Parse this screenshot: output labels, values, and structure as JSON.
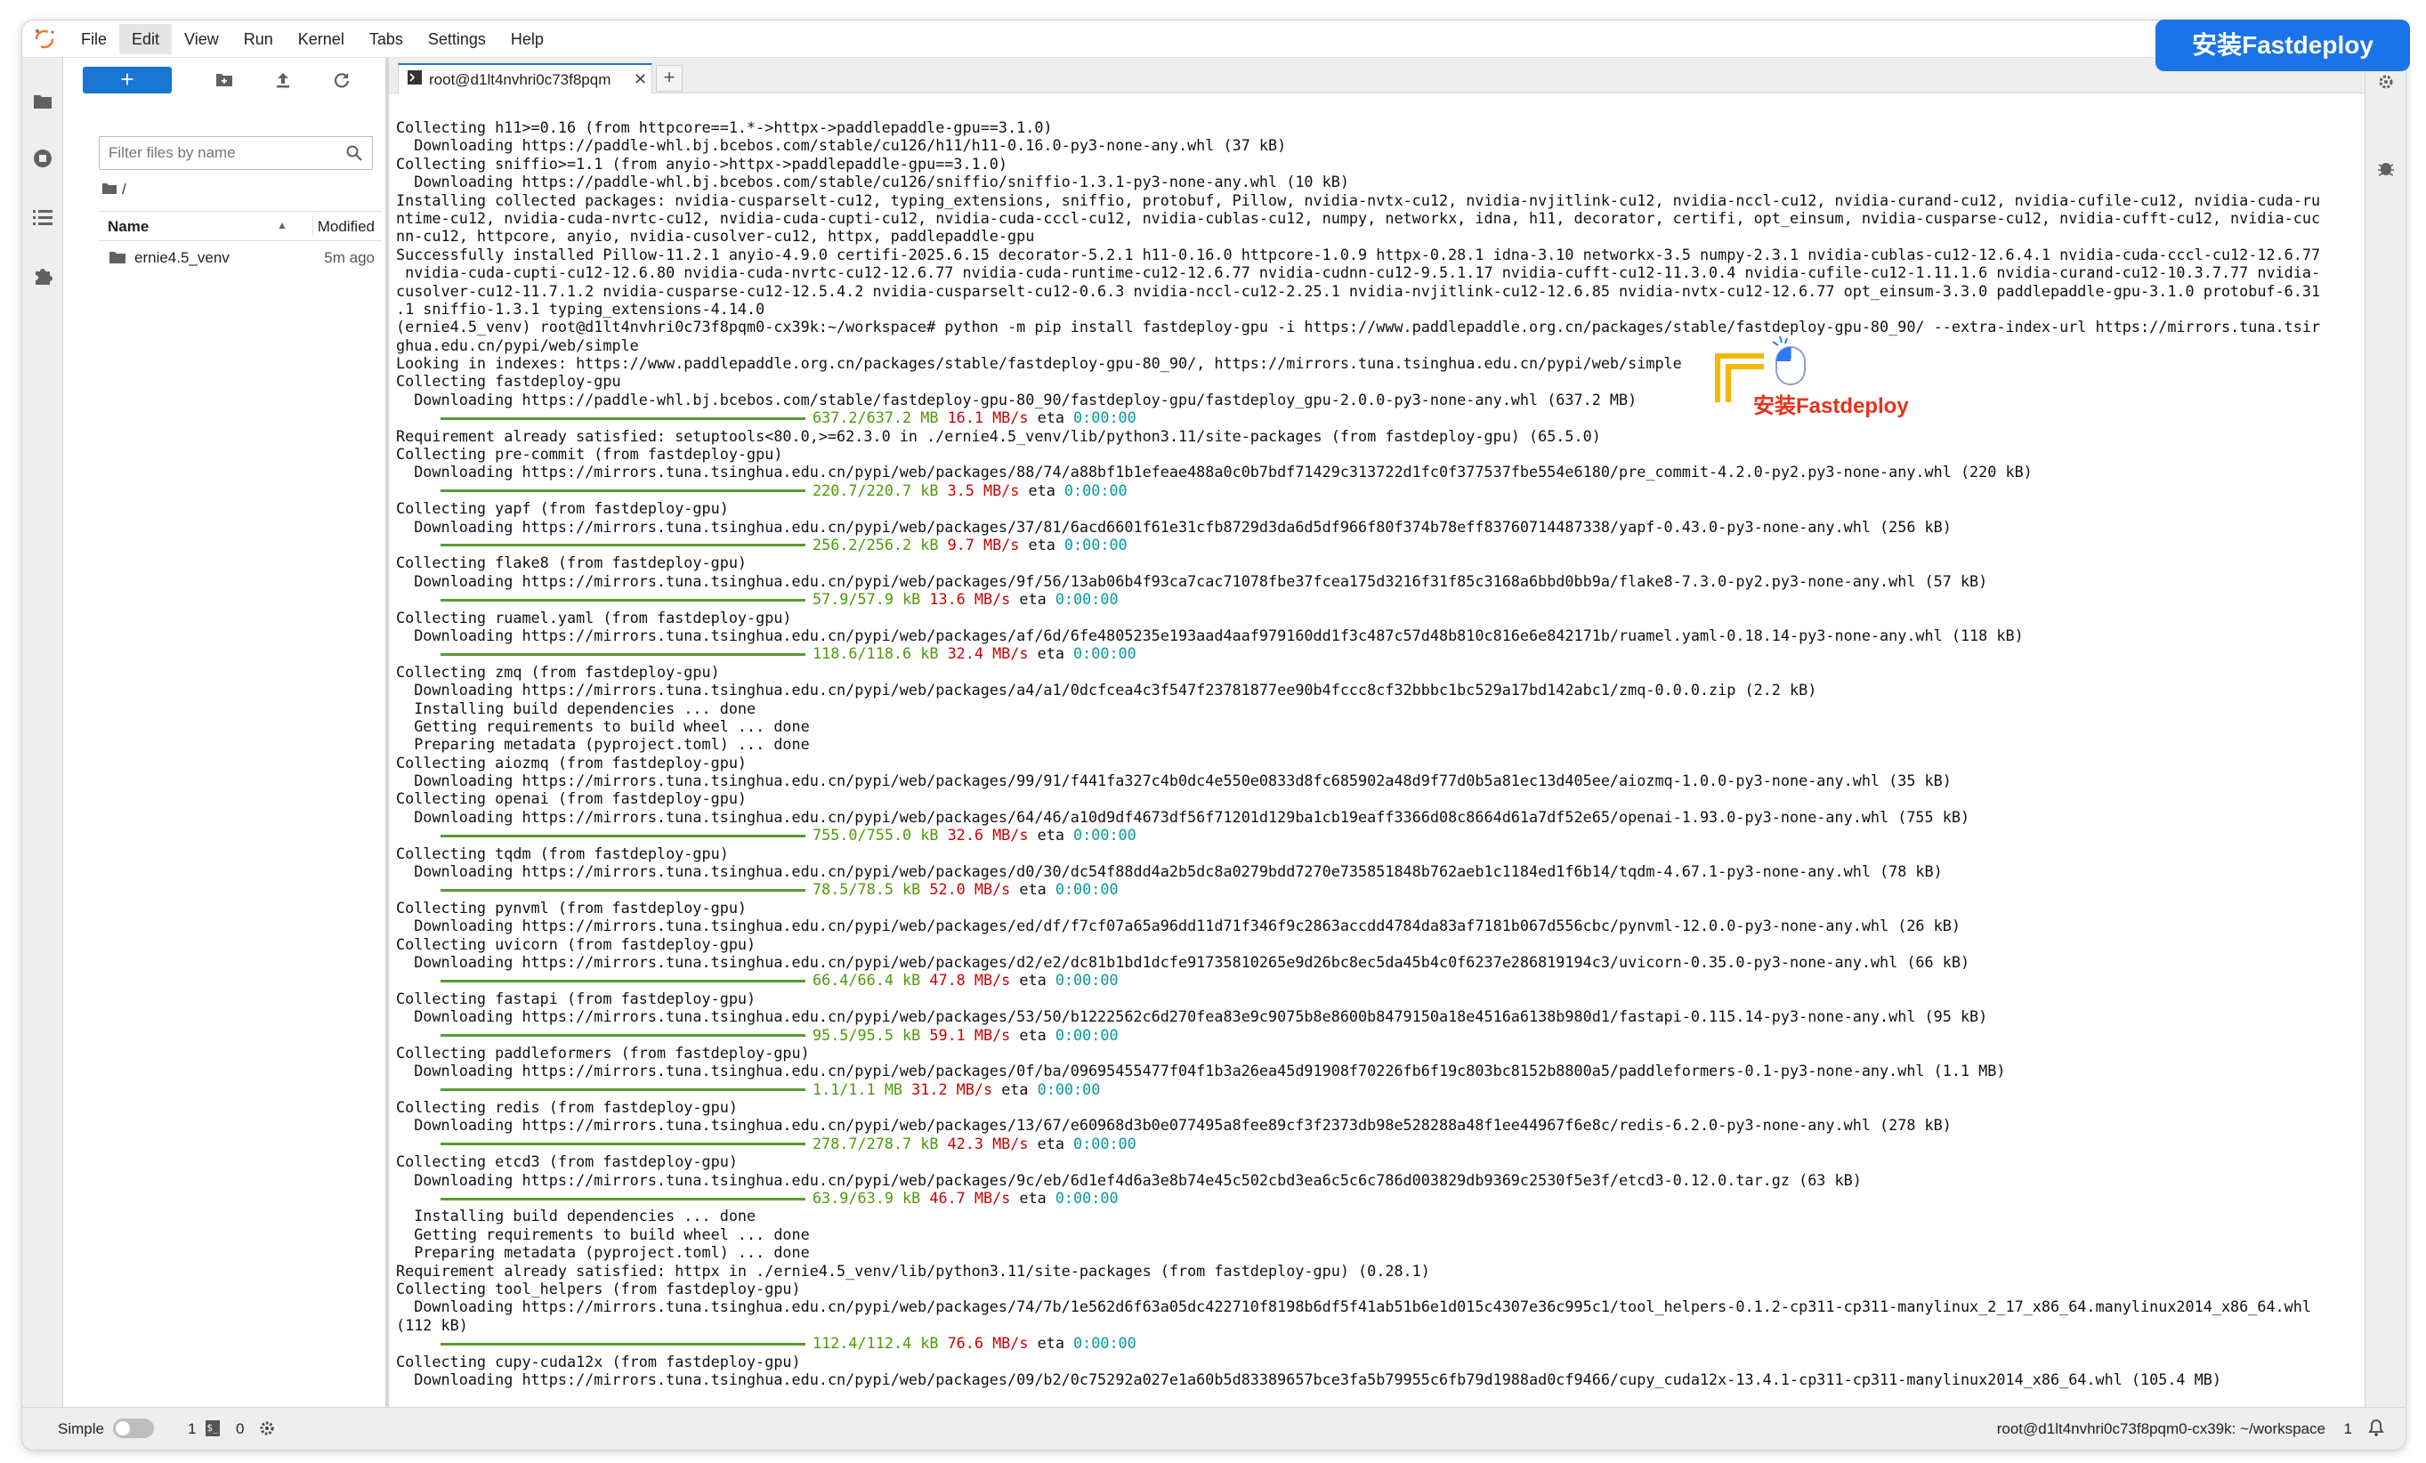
{
  "menubar": {
    "items": [
      "File",
      "Edit",
      "View",
      "Run",
      "Kernel",
      "Tabs",
      "Settings",
      "Help"
    ],
    "active": "Edit"
  },
  "banner": {
    "text": "安装Fastdeploy"
  },
  "filebrowser": {
    "new_label": "+",
    "search_placeholder": "Filter files by name",
    "breadcrumb": "/",
    "columns": {
      "name": "Name",
      "modified": "Modified"
    },
    "rows": [
      {
        "name": "ernie4.5_venv",
        "modified": "5m ago"
      }
    ]
  },
  "tab": {
    "label": "root@d1lt4nvhri0c73f8pqm",
    "new_tab": "+"
  },
  "overlay": {
    "label": "安装Fastdeploy"
  },
  "status": {
    "mode_label": "Simple",
    "terminals": "1",
    "kernels": "0",
    "host": "root@d1lt4nvhri0c73f8pqm0-cx39k: ~/workspace",
    "count": "1"
  },
  "terminal": {
    "lines": [
      {
        "t": "Collecting h11>=0.16 (from httpcore==1.*->httpx->paddlepaddle-gpu==3.1.0)"
      },
      {
        "t": "  Downloading https://paddle-whl.bj.bcebos.com/stable/cu126/h11/h11-0.16.0-py3-none-any.whl (37 kB)"
      },
      {
        "t": "Collecting sniffio>=1.1 (from anyio->httpx->paddlepaddle-gpu==3.1.0)"
      },
      {
        "t": "  Downloading https://paddle-whl.bj.bcebos.com/stable/cu126/sniffio/sniffio-1.3.1-py3-none-any.whl (10 kB)"
      },
      {
        "t": "Installing collected packages: nvidia-cusparselt-cu12, typing_extensions, sniffio, protobuf, Pillow, nvidia-nvtx-cu12, nvidia-nvjitlink-cu12, nvidia-nccl-cu12, nvidia-curand-cu12, nvidia-cufile-cu12, nvidia-cuda-ru"
      },
      {
        "t": "ntime-cu12, nvidia-cuda-nvrtc-cu12, nvidia-cuda-cupti-cu12, nvidia-cuda-cccl-cu12, nvidia-cublas-cu12, numpy, networkx, idna, h11, decorator, certifi, opt_einsum, nvidia-cusparse-cu12, nvidia-cufft-cu12, nvidia-cuc"
      },
      {
        "t": "nn-cu12, httpcore, anyio, nvidia-cusolver-cu12, httpx, paddlepaddle-gpu"
      },
      {
        "t": "Successfully installed Pillow-11.2.1 anyio-4.9.0 certifi-2025.6.15 decorator-5.2.1 h11-0.16.0 httpcore-1.0.9 httpx-0.28.1 idna-3.10 networkx-3.5 numpy-2.3.1 nvidia-cublas-cu12-12.6.4.1 nvidia-cuda-cccl-cu12-12.6.77"
      },
      {
        "t": " nvidia-cuda-cupti-cu12-12.6.80 nvidia-cuda-nvrtc-cu12-12.6.77 nvidia-cuda-runtime-cu12-12.6.77 nvidia-cudnn-cu12-9.5.1.17 nvidia-cufft-cu12-11.3.0.4 nvidia-cufile-cu12-1.11.1.6 nvidia-curand-cu12-10.3.7.77 nvidia-"
      },
      {
        "t": "cusolver-cu12-11.7.1.2 nvidia-cusparse-cu12-12.5.4.2 nvidia-cusparselt-cu12-0.6.3 nvidia-nccl-cu12-2.25.1 nvidia-nvjitlink-cu12-12.6.85 nvidia-nvtx-cu12-12.6.77 opt_einsum-3.3.0 paddlepaddle-gpu-3.1.0 protobuf-6.31"
      },
      {
        "t": ".1 sniffio-1.3.1 typing_extensions-4.14.0"
      },
      {
        "t": "(ernie4.5_venv) root@d1lt4nvhri0c73f8pqm0-cx39k:~/workspace# python -m pip install fastdeploy-gpu -i https://www.paddlepaddle.org.cn/packages/stable/fastdeploy-gpu-80_90/ --extra-index-url https://mirrors.tuna.tsir"
      },
      {
        "t": "ghua.edu.cn/pypi/web/simple"
      },
      {
        "t": "Looking in indexes: https://www.paddlepaddle.org.cn/packages/stable/fastdeploy-gpu-80_90/, https://mirrors.tuna.tsinghua.edu.cn/pypi/web/simple"
      },
      {
        "t": "Collecting fastdeploy-gpu"
      },
      {
        "t": "  Downloading https://paddle-whl.bj.bcebos.com/stable/fastdeploy-gpu-80_90/fastdeploy-gpu/fastdeploy_gpu-2.0.0-py3-none-any.whl (637.2 MB)"
      },
      {
        "p": [
          "637.2/637.2 MB",
          "16.1 MB/s",
          "0:00:00"
        ]
      },
      {
        "t": "Requirement already satisfied: setuptools<80.0,>=62.3.0 in ./ernie4.5_venv/lib/python3.11/site-packages (from fastdeploy-gpu) (65.5.0)"
      },
      {
        "t": "Collecting pre-commit (from fastdeploy-gpu)"
      },
      {
        "t": "  Downloading https://mirrors.tuna.tsinghua.edu.cn/pypi/web/packages/88/74/a88bf1b1efeae488a0c0b7bdf71429c313722d1fc0f377537fbe554e6180/pre_commit-4.2.0-py2.py3-none-any.whl (220 kB)"
      },
      {
        "p": [
          "220.7/220.7 kB",
          "3.5 MB/s",
          "0:00:00"
        ]
      },
      {
        "t": "Collecting yapf (from fastdeploy-gpu)"
      },
      {
        "t": "  Downloading https://mirrors.tuna.tsinghua.edu.cn/pypi/web/packages/37/81/6acd6601f61e31cfb8729d3da6d5df966f80f374b78eff83760714487338/yapf-0.43.0-py3-none-any.whl (256 kB)"
      },
      {
        "p": [
          "256.2/256.2 kB",
          "9.7 MB/s",
          "0:00:00"
        ]
      },
      {
        "t": "Collecting flake8 (from fastdeploy-gpu)"
      },
      {
        "t": "  Downloading https://mirrors.tuna.tsinghua.edu.cn/pypi/web/packages/9f/56/13ab06b4f93ca7cac71078fbe37fcea175d3216f31f85c3168a6bbd0bb9a/flake8-7.3.0-py2.py3-none-any.whl (57 kB)"
      },
      {
        "p": [
          "57.9/57.9 kB",
          "13.6 MB/s",
          "0:00:00"
        ]
      },
      {
        "t": "Collecting ruamel.yaml (from fastdeploy-gpu)"
      },
      {
        "t": "  Downloading https://mirrors.tuna.tsinghua.edu.cn/pypi/web/packages/af/6d/6fe4805235e193aad4aaf979160dd1f3c487c57d48b810c816e6e842171b/ruamel.yaml-0.18.14-py3-none-any.whl (118 kB)"
      },
      {
        "p": [
          "118.6/118.6 kB",
          "32.4 MB/s",
          "0:00:00"
        ]
      },
      {
        "t": "Collecting zmq (from fastdeploy-gpu)"
      },
      {
        "t": "  Downloading https://mirrors.tuna.tsinghua.edu.cn/pypi/web/packages/a4/a1/0dcfcea4c3f547f23781877ee90b4fccc8cf32bbbc1bc529a17bd142abc1/zmq-0.0.0.zip (2.2 kB)"
      },
      {
        "t": "  Installing build dependencies ... done"
      },
      {
        "t": "  Getting requirements to build wheel ... done"
      },
      {
        "t": "  Preparing metadata (pyproject.toml) ... done"
      },
      {
        "t": "Collecting aiozmq (from fastdeploy-gpu)"
      },
      {
        "t": "  Downloading https://mirrors.tuna.tsinghua.edu.cn/pypi/web/packages/99/91/f441fa327c4b0dc4e550e0833d8fc685902a48d9f77d0b5a81ec13d405ee/aiozmq-1.0.0-py3-none-any.whl (35 kB)"
      },
      {
        "t": "Collecting openai (from fastdeploy-gpu)"
      },
      {
        "t": "  Downloading https://mirrors.tuna.tsinghua.edu.cn/pypi/web/packages/64/46/a10d9df4673df56f71201d129ba1cb19eaff3366d08c8664d61a7df52e65/openai-1.93.0-py3-none-any.whl (755 kB)"
      },
      {
        "p": [
          "755.0/755.0 kB",
          "32.6 MB/s",
          "0:00:00"
        ]
      },
      {
        "t": "Collecting tqdm (from fastdeploy-gpu)"
      },
      {
        "t": "  Downloading https://mirrors.tuna.tsinghua.edu.cn/pypi/web/packages/d0/30/dc54f88dd4a2b5dc8a0279bdd7270e735851848b762aeb1c1184ed1f6b14/tqdm-4.67.1-py3-none-any.whl (78 kB)"
      },
      {
        "p": [
          "78.5/78.5 kB",
          "52.0 MB/s",
          "0:00:00"
        ]
      },
      {
        "t": "Collecting pynvml (from fastdeploy-gpu)"
      },
      {
        "t": "  Downloading https://mirrors.tuna.tsinghua.edu.cn/pypi/web/packages/ed/df/f7cf07a65a96dd11d71f346f9c2863accdd4784da83af7181b067d556cbc/pynvml-12.0.0-py3-none-any.whl (26 kB)"
      },
      {
        "t": "Collecting uvicorn (from fastdeploy-gpu)"
      },
      {
        "t": "  Downloading https://mirrors.tuna.tsinghua.edu.cn/pypi/web/packages/d2/e2/dc81b1bd1dcfe91735810265e9d26bc8ec5da45b4c0f6237e286819194c3/uvicorn-0.35.0-py3-none-any.whl (66 kB)"
      },
      {
        "p": [
          "66.4/66.4 kB",
          "47.8 MB/s",
          "0:00:00"
        ]
      },
      {
        "t": "Collecting fastapi (from fastdeploy-gpu)"
      },
      {
        "t": "  Downloading https://mirrors.tuna.tsinghua.edu.cn/pypi/web/packages/53/50/b1222562c6d270fea83e9c9075b8e8600b8479150a18e4516a6138b980d1/fastapi-0.115.14-py3-none-any.whl (95 kB)"
      },
      {
        "p": [
          "95.5/95.5 kB",
          "59.1 MB/s",
          "0:00:00"
        ]
      },
      {
        "t": "Collecting paddleformers (from fastdeploy-gpu)"
      },
      {
        "t": "  Downloading https://mirrors.tuna.tsinghua.edu.cn/pypi/web/packages/0f/ba/09695455477f04f1b3a26ea45d91908f70226fb6f19c803bc8152b8800a5/paddleformers-0.1-py3-none-any.whl (1.1 MB)"
      },
      {
        "p": [
          "1.1/1.1 MB",
          "31.2 MB/s",
          "0:00:00"
        ]
      },
      {
        "t": "Collecting redis (from fastdeploy-gpu)"
      },
      {
        "t": "  Downloading https://mirrors.tuna.tsinghua.edu.cn/pypi/web/packages/13/67/e60968d3b0e077495a8fee89cf3f2373db98e528288a48f1ee44967f6e8c/redis-6.2.0-py3-none-any.whl (278 kB)"
      },
      {
        "p": [
          "278.7/278.7 kB",
          "42.3 MB/s",
          "0:00:00"
        ]
      },
      {
        "t": "Collecting etcd3 (from fastdeploy-gpu)"
      },
      {
        "t": "  Downloading https://mirrors.tuna.tsinghua.edu.cn/pypi/web/packages/9c/eb/6d1ef4d6a3e8b74e45c502cbd3ea6c5c6c786d003829db9369c2530f5e3f/etcd3-0.12.0.tar.gz (63 kB)"
      },
      {
        "p": [
          "63.9/63.9 kB",
          "46.7 MB/s",
          "0:00:00"
        ]
      },
      {
        "t": "  Installing build dependencies ... done"
      },
      {
        "t": "  Getting requirements to build wheel ... done"
      },
      {
        "t": "  Preparing metadata (pyproject.toml) ... done"
      },
      {
        "t": "Requirement already satisfied: httpx in ./ernie4.5_venv/lib/python3.11/site-packages (from fastdeploy-gpu) (0.28.1)"
      },
      {
        "t": "Collecting tool_helpers (from fastdeploy-gpu)"
      },
      {
        "t": "  Downloading https://mirrors.tuna.tsinghua.edu.cn/pypi/web/packages/74/7b/1e562d6f63a05dc422710f8198b6df5f41ab51b6e1d015c4307e36c995c1/tool_helpers-0.1.2-cp311-cp311-manylinux_2_17_x86_64.manylinux2014_x86_64.whl"
      },
      {
        "t": "(112 kB)"
      },
      {
        "p": [
          "112.4/112.4 kB",
          "76.6 MB/s",
          "0:00:00"
        ]
      },
      {
        "t": "Collecting cupy-cuda12x (from fastdeploy-gpu)"
      },
      {
        "t": "  Downloading https://mirrors.tuna.tsinghua.edu.cn/pypi/web/packages/09/b2/0c75292a027e1a60b5d83389657bce3fa5b79955c6fb79d1988ad0cf9466/cupy_cuda12x-13.4.1-cp311-cp311-manylinux2014_x86_64.whl (105.4 MB)"
      }
    ],
    "eta_label": "eta"
  }
}
